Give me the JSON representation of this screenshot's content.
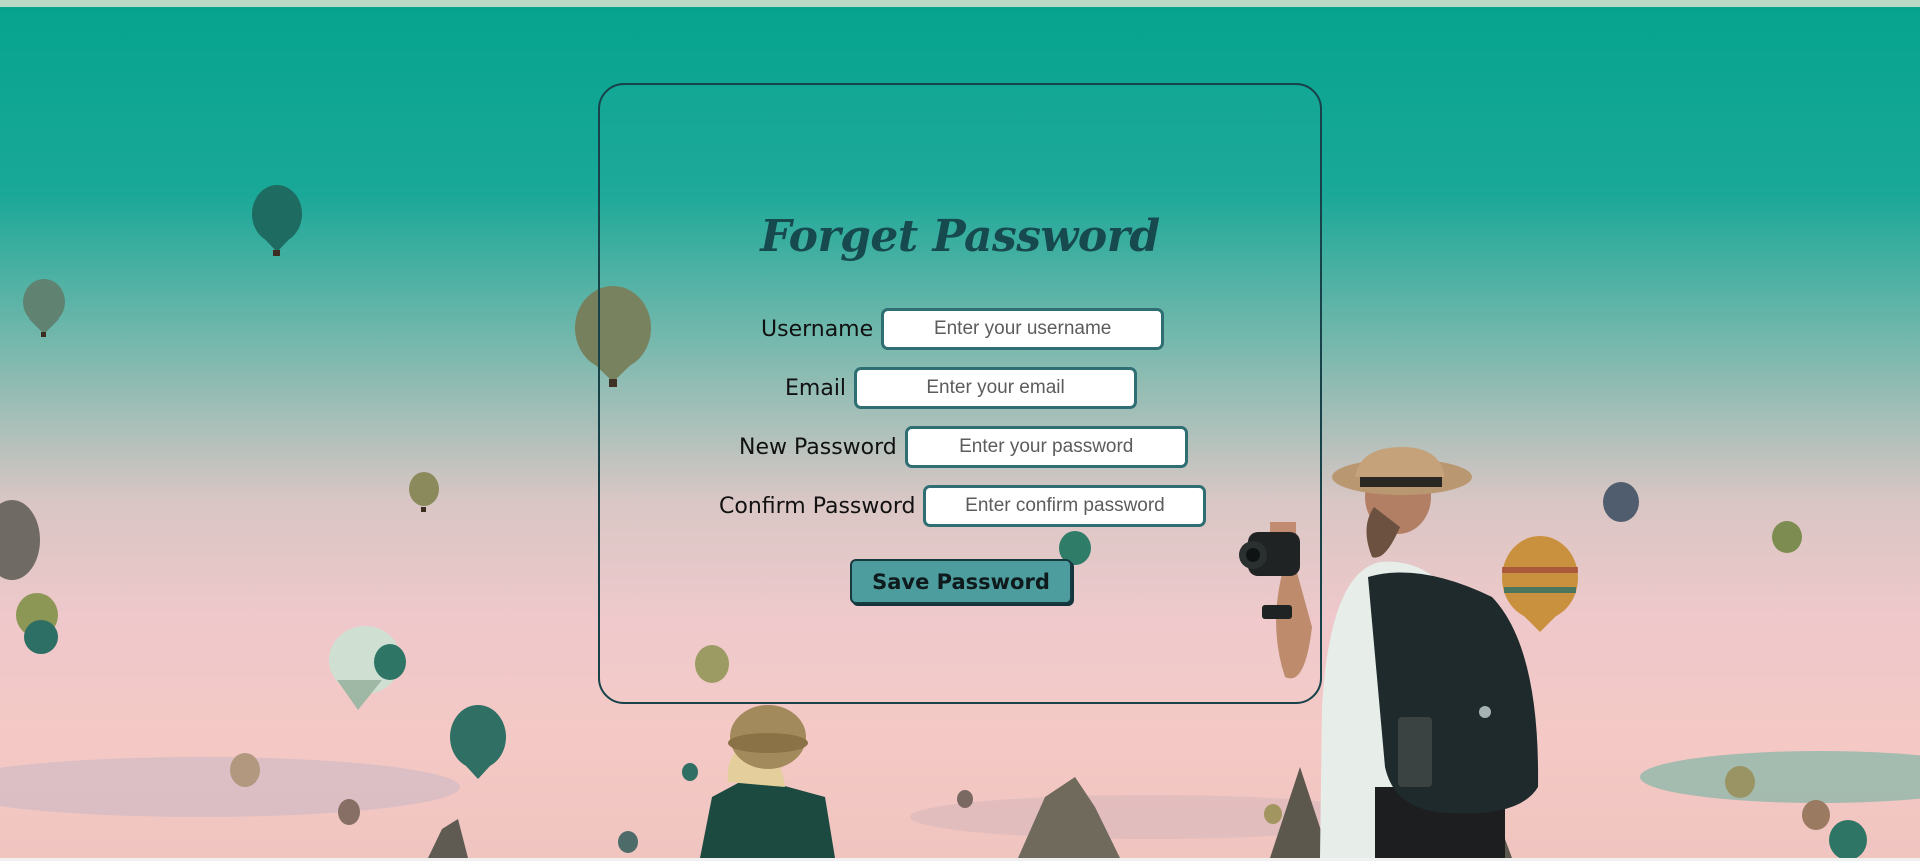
{
  "form": {
    "title": "Forget Password",
    "fields": [
      {
        "label": "Username",
        "placeholder": "Enter your username",
        "value": ""
      },
      {
        "label": "Email",
        "placeholder": "Enter your email",
        "value": ""
      },
      {
        "label": "New Password",
        "placeholder": "Enter your password",
        "value": ""
      },
      {
        "label": "Confirm Password",
        "placeholder": "Enter confirm password",
        "value": ""
      }
    ],
    "save_label": "Save Password"
  },
  "colors": {
    "sky_top": "#06a48f",
    "sky_bottom": "#f4c9c5",
    "card_border": "#17424a",
    "title": "#164a4f",
    "input_border": "#2f6f74",
    "button_bg": "#4e9d9e"
  },
  "icons": [
    "hot-air-balloon-icon",
    "photographer-figure",
    "girl-with-hat-figure"
  ]
}
